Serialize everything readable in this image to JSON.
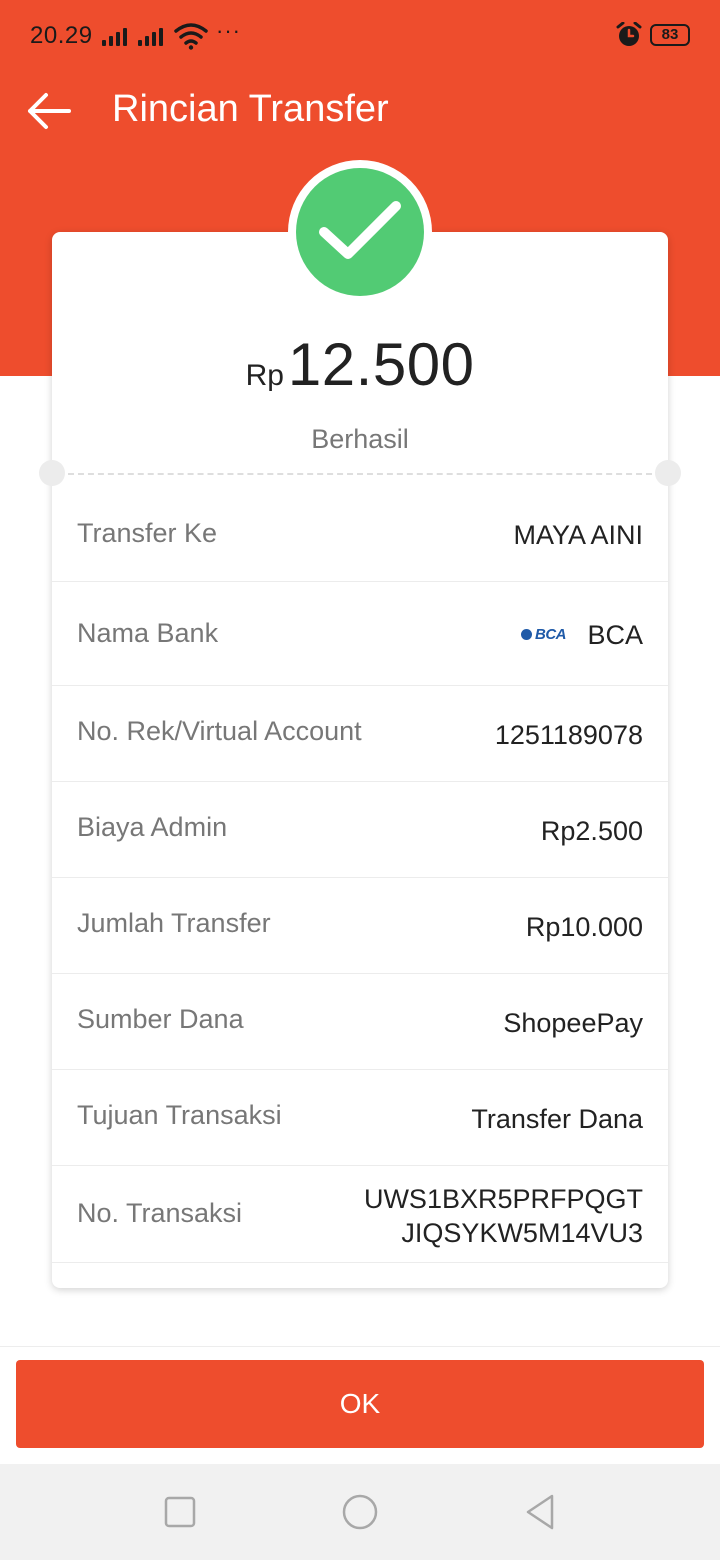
{
  "status_bar": {
    "time": "20.29",
    "more": "···",
    "battery": "83",
    "icons": [
      "signal-icon",
      "signal-icon",
      "wifi-icon",
      "alarm-icon",
      "battery-icon"
    ]
  },
  "header": {
    "title": "Rincian Transfer",
    "back_icon": "back-arrow-icon"
  },
  "summary": {
    "currency": "Rp",
    "amount": "12.500",
    "status": "Berhasil",
    "status_icon": "check-icon",
    "status_color": "#52cb74"
  },
  "details": [
    {
      "label": "Transfer Ke",
      "value": "MAYA AINI"
    },
    {
      "label": "Nama Bank",
      "value": "BCA",
      "logo": "BCA"
    },
    {
      "label": "No. Rek/Virtual Account",
      "value": "1251189078"
    },
    {
      "label": "Biaya Admin",
      "value": "Rp2.500"
    },
    {
      "label": "Jumlah Transfer",
      "value": "Rp10.000"
    },
    {
      "label": "Sumber Dana",
      "value": "ShopeePay"
    },
    {
      "label": "Tujuan Transaksi",
      "value": "Transfer Dana"
    },
    {
      "label": "No. Transaksi",
      "value_line1": "UWS1BXR5PRFPQGT",
      "value_line2": "JIQSYKW5M14VU3"
    }
  ],
  "actions": {
    "ok_label": "OK"
  },
  "nav": {
    "icons": [
      "recent-apps-icon",
      "home-icon",
      "back-icon"
    ]
  },
  "colors": {
    "accent": "#ee4d2d",
    "success": "#52cb74"
  }
}
